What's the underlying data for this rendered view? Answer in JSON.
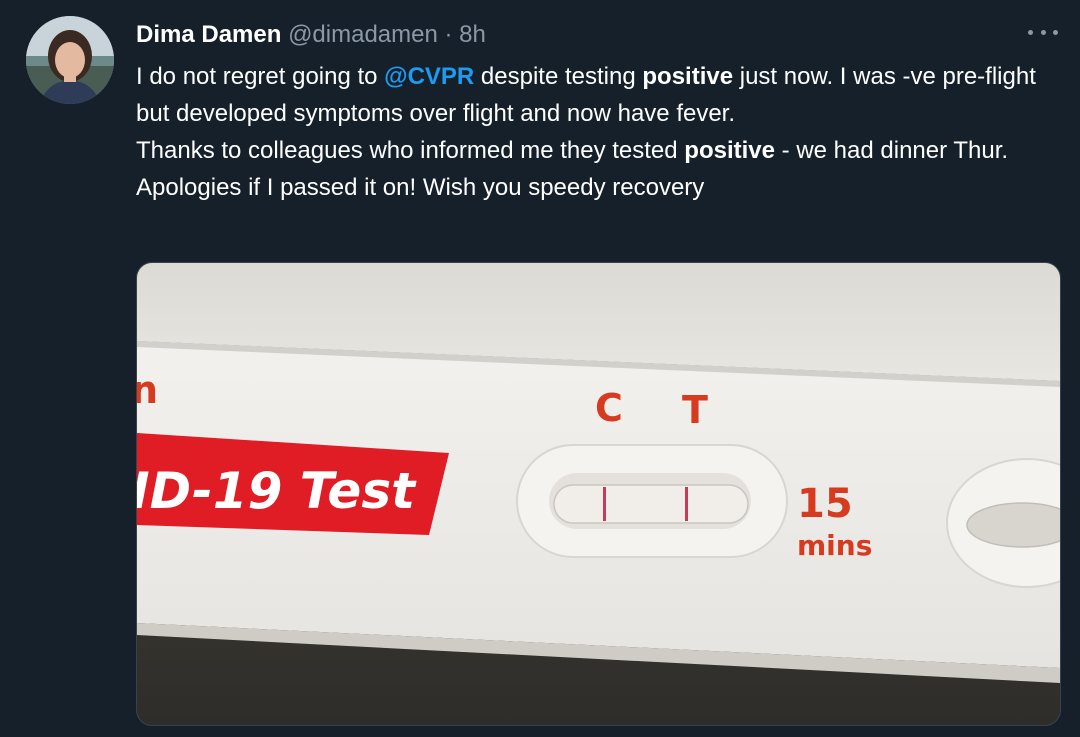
{
  "author": {
    "name": "Dima Damen",
    "handle": "@dimadamen",
    "separator": "·",
    "time": "8h"
  },
  "tweet": {
    "line1": {
      "pre": "I do not regret going to ",
      "mention": "@CVPR",
      "mid": " despite testing ",
      "bold": "positive",
      "post": " just now. I was -ve pre-flight but developed symptoms over flight and now have fever."
    },
    "line2": {
      "pre": "Thanks to colleagues who informed me they tested ",
      "bold": "positive",
      "post": " - we had dinner Thur."
    },
    "line3": "Apologies if I passed it on! Wish you speedy recovery"
  },
  "media": {
    "description_icon": "covid-test-photo",
    "strip_label": "ID-19 Test",
    "partial_letter": "n",
    "control_label": "C",
    "test_label": "T",
    "timer_value": "15",
    "timer_unit": "mins",
    "colors": {
      "red_band": "#e01c24",
      "red_text": "#d63a1f",
      "plastic": "#eceae6"
    }
  },
  "icons": {
    "more": "more-dots-icon",
    "avatar": "avatar"
  }
}
